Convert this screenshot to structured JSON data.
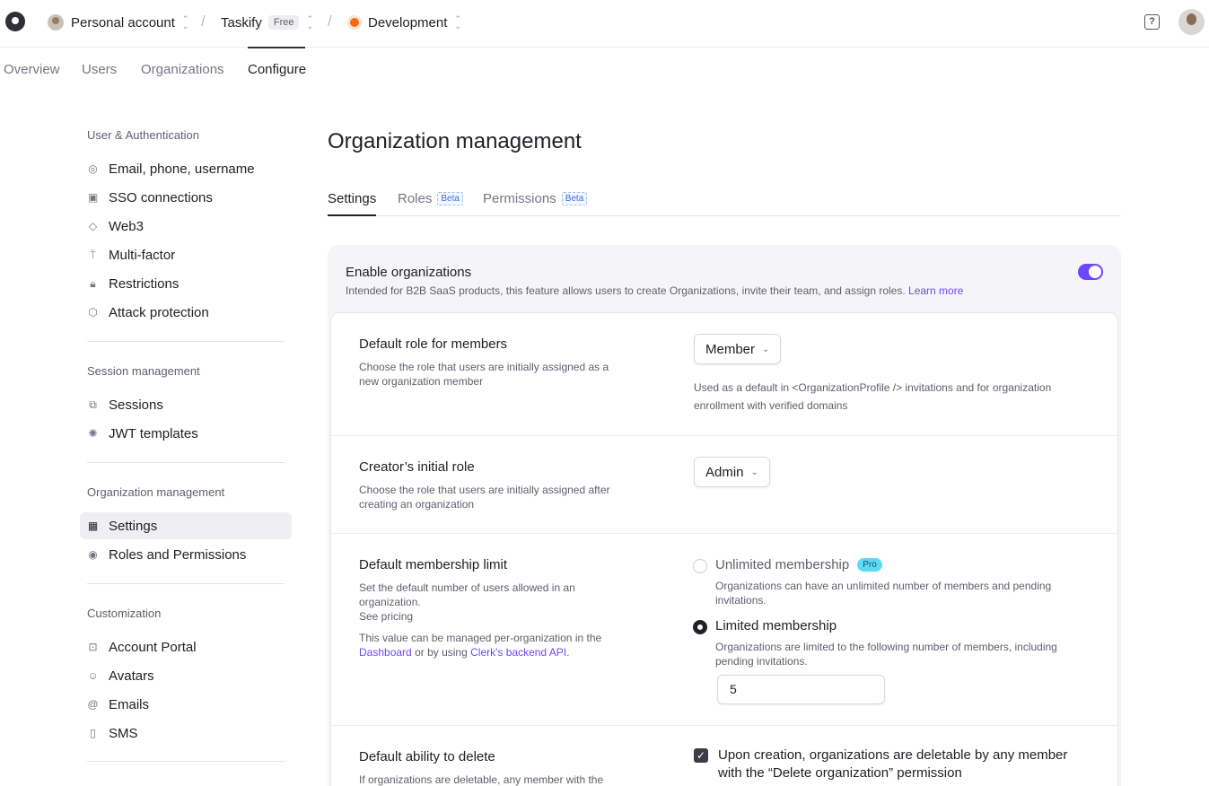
{
  "topbar": {
    "account": "Personal account",
    "app": "Taskify",
    "plan_badge": "Free",
    "instance": "Development",
    "help_icon": "question-icon"
  },
  "mainnav": {
    "items": [
      "Overview",
      "Users",
      "Organizations",
      "Configure"
    ],
    "active": "Configure"
  },
  "sidebar": {
    "sections": [
      {
        "title": "User & Authentication",
        "items": [
          {
            "label": "Email, phone, username",
            "icon": "fingerprint-icon"
          },
          {
            "label": "SSO connections",
            "icon": "sso-icon"
          },
          {
            "label": "Web3",
            "icon": "web3-icon"
          },
          {
            "label": "Multi-factor",
            "icon": "multi-factor-icon"
          },
          {
            "label": "Restrictions",
            "icon": "lock-icon"
          },
          {
            "label": "Attack protection",
            "icon": "shield-icon"
          }
        ]
      },
      {
        "title": "Session management",
        "items": [
          {
            "label": "Sessions",
            "icon": "sessions-icon"
          },
          {
            "label": "JWT templates",
            "icon": "jwt-icon"
          }
        ]
      },
      {
        "title": "Organization management",
        "items": [
          {
            "label": "Settings",
            "icon": "building-icon",
            "active": true
          },
          {
            "label": "Roles and Permissions",
            "icon": "roles-icon"
          }
        ]
      },
      {
        "title": "Customization",
        "items": [
          {
            "label": "Account Portal",
            "icon": "portal-icon"
          },
          {
            "label": "Avatars",
            "icon": "avatar-icon"
          },
          {
            "label": "Emails",
            "icon": "at-icon"
          },
          {
            "label": "SMS",
            "icon": "sms-icon"
          }
        ]
      }
    ]
  },
  "page": {
    "title": "Organization management",
    "tabs": [
      {
        "label": "Settings",
        "badge": ""
      },
      {
        "label": "Roles",
        "badge": "Beta"
      },
      {
        "label": "Permissions",
        "badge": "Beta"
      }
    ]
  },
  "enable": {
    "title": "Enable organizations",
    "description": "Intended for B2B SaaS products, this feature allows users to create Organizations, invite their team, and assign roles.",
    "learn_more": "Learn more",
    "enabled": true,
    "accent_color": "#6c47ff"
  },
  "settings": {
    "default_role": {
      "title": "Default role for members",
      "description": "Choose the role that users are initially assigned as a new organization member",
      "value": "Member",
      "help": "Used as a default in <OrganizationProfile /> invitations and for organization enrollment with verified domains"
    },
    "creator_role": {
      "title": "Creator’s initial role",
      "description": "Choose the role that users are initially assigned after creating an organization",
      "value": "Admin"
    },
    "membership_limit": {
      "title": "Default membership limit",
      "description": "Set the default number of users allowed in an organization.",
      "see_pricing": "See pricing",
      "note_prefix": "This value can be managed per-organization in the",
      "note_link1": "Dashboard",
      "note_mid": "or by using",
      "note_link2": "Clerk's backend API",
      "note_suffix": ".",
      "unlimited_label": "Unlimited membership",
      "unlimited_badge": "Pro",
      "unlimited_desc": "Organizations can have an unlimited number of members and pending invitations.",
      "limited_label": "Limited membership",
      "limited_desc": "Organizations are limited to the following number of members, including pending invitations.",
      "limit_value": "5",
      "selected": "limited"
    },
    "delete_ability": {
      "title": "Default ability to delete",
      "description": "If organizations are deletable, any member with the",
      "checkbox_label": "Upon creation, organizations are deletable by any member with the “Delete organization” permission",
      "checked": true
    }
  }
}
